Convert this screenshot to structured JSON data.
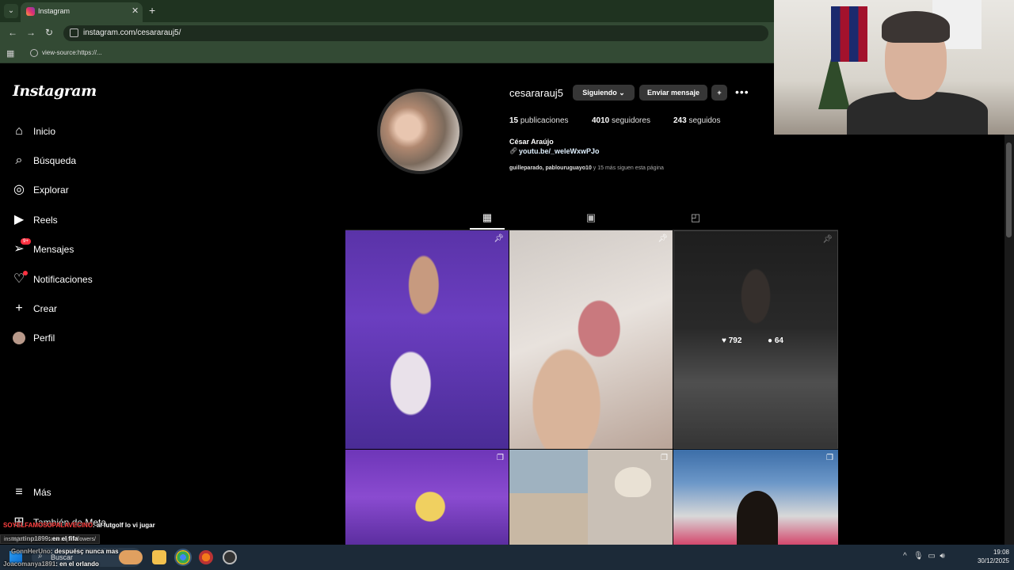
{
  "browser": {
    "tab_title": "Instagram",
    "new_tab": "+",
    "url": "instagram.com/cesararauj5/",
    "bookmark": "view-source:https://..."
  },
  "sidebar": {
    "logo": "Instagram",
    "items": [
      {
        "label": "Inicio",
        "icon": "home-icon"
      },
      {
        "label": "Búsqueda",
        "icon": "search-icon"
      },
      {
        "label": "Explorar",
        "icon": "compass-icon"
      },
      {
        "label": "Reels",
        "icon": "reels-icon"
      },
      {
        "label": "Mensajes",
        "icon": "messenger-icon",
        "badge": "9+"
      },
      {
        "label": "Notificaciones",
        "icon": "heart-icon"
      },
      {
        "label": "Crear",
        "icon": "plus-icon"
      },
      {
        "label": "Perfil",
        "icon": "avatar-icon"
      }
    ],
    "more": "Más",
    "also_meta": "También de Meta"
  },
  "profile": {
    "username": "cesararauj5",
    "following_button": "Siguiendo",
    "message_button": "Enviar mensaje",
    "posts_count": "15",
    "posts_label": "publicaciones",
    "followers_count": "4010",
    "followers_label": "seguidores",
    "following_count": "243",
    "following_label": "seguidos",
    "full_name": "César Araújo",
    "link": "youtu.be/_weleWxwPJo",
    "followed_by_names": "guilleparado, pablouruguayo10",
    "followed_by_rest": " y 15 más siguen esta página"
  },
  "tabs": [
    "grid-icon",
    "reels-icon",
    "tagged-icon"
  ],
  "posts": [
    {
      "pinned": true
    },
    {
      "pinned": true
    },
    {
      "pinned": true,
      "likes": "792",
      "comments": "64"
    },
    {
      "pinned": false
    },
    {
      "pinned": false
    },
    {
      "pinned": false
    }
  ],
  "chat": [
    {
      "user": "SOYELFAMOSOPALAVECINO",
      "msg": ": al futgolf lo vi jugar"
    },
    {
      "user": "martinp1899",
      "msg": ": en el fifa"
    },
    {
      "user": "GonnHerUno",
      "msg": ": despuésç nunca mas"
    },
    {
      "user": "Joacomanya1891",
      "msg": ": en el orlando"
    }
  ],
  "status_url": "instagram.com/cesararauj5/followers/",
  "taskbar": {
    "search": "Buscar",
    "time": "19:08",
    "date": "30/12/2025"
  },
  "colors": {
    "background": "#000000",
    "badge": "#ff3040",
    "button": "#363636",
    "browser_chrome": "#334a34"
  }
}
